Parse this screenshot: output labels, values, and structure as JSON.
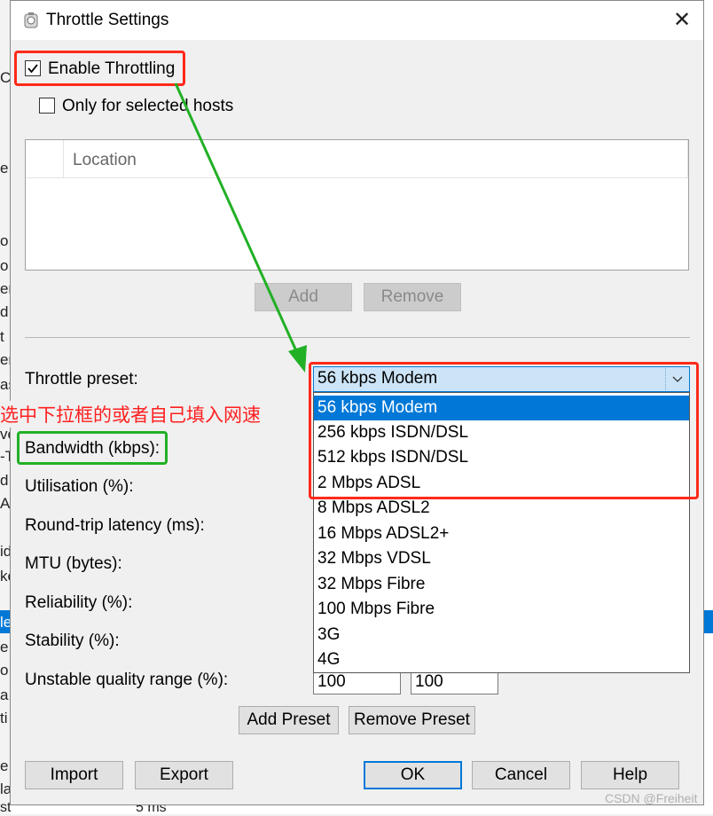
{
  "background_app": {
    "left_fragments": [
      "C",
      "e",
      "o",
      "o",
      "er",
      "d",
      "t",
      "er",
      "as",
      "ve",
      "-T",
      "d",
      "A",
      "id",
      "ke",
      "le",
      "e",
      "o",
      "a",
      "ti",
      "e",
      "la"
    ],
    "bottom_row_left": "st",
    "bottom_row_value": "5 ms"
  },
  "dialog": {
    "title": "Throttle Settings",
    "close_glyph": "✕",
    "enable_throttling": {
      "label": "Enable Throttling",
      "checked": true
    },
    "only_selected_hosts": {
      "label": "Only for selected hosts",
      "checked": false
    },
    "hosts_table": {
      "column": "Location"
    },
    "add_button": "Add",
    "remove_button": "Remove",
    "throttle_preset_label": "Throttle preset:",
    "preset_selected": "56 kbps Modem",
    "preset_options": [
      "56 kbps Modem",
      "256 kbps ISDN/DSL",
      "512 kbps ISDN/DSL",
      "2 Mbps ADSL",
      "8 Mbps ADSL2",
      "16 Mbps ADSL2+",
      "32 Mbps VDSL",
      "32 Mbps Fibre",
      "100 Mbps Fibre",
      "3G",
      "4G"
    ],
    "fields": {
      "bandwidth_label": "Bandwidth (kbps):",
      "utilisation_label": "Utilisation (%):",
      "latency_label": "Round-trip latency (ms):",
      "mtu_label": "MTU (bytes):",
      "reliability_label": "Reliability (%):",
      "stability_label": "Stability (%):",
      "unstable_label": "Unstable quality range (%):",
      "unstable_min": "100",
      "unstable_max": "100"
    },
    "add_preset_button": "Add Preset",
    "remove_preset_button": "Remove Preset",
    "import_button": "Import",
    "export_button": "Export",
    "ok_button": "OK",
    "cancel_button": "Cancel",
    "help_button": "Help"
  },
  "annotation": {
    "text": "选中下拉框的或者自己填入网速",
    "red": "#ff2a1a",
    "green": "#22b026"
  },
  "watermark": "CSDN @Freiheit",
  "colors": {
    "selection": "#0078d7",
    "combo_bg": "#cce4f7"
  }
}
